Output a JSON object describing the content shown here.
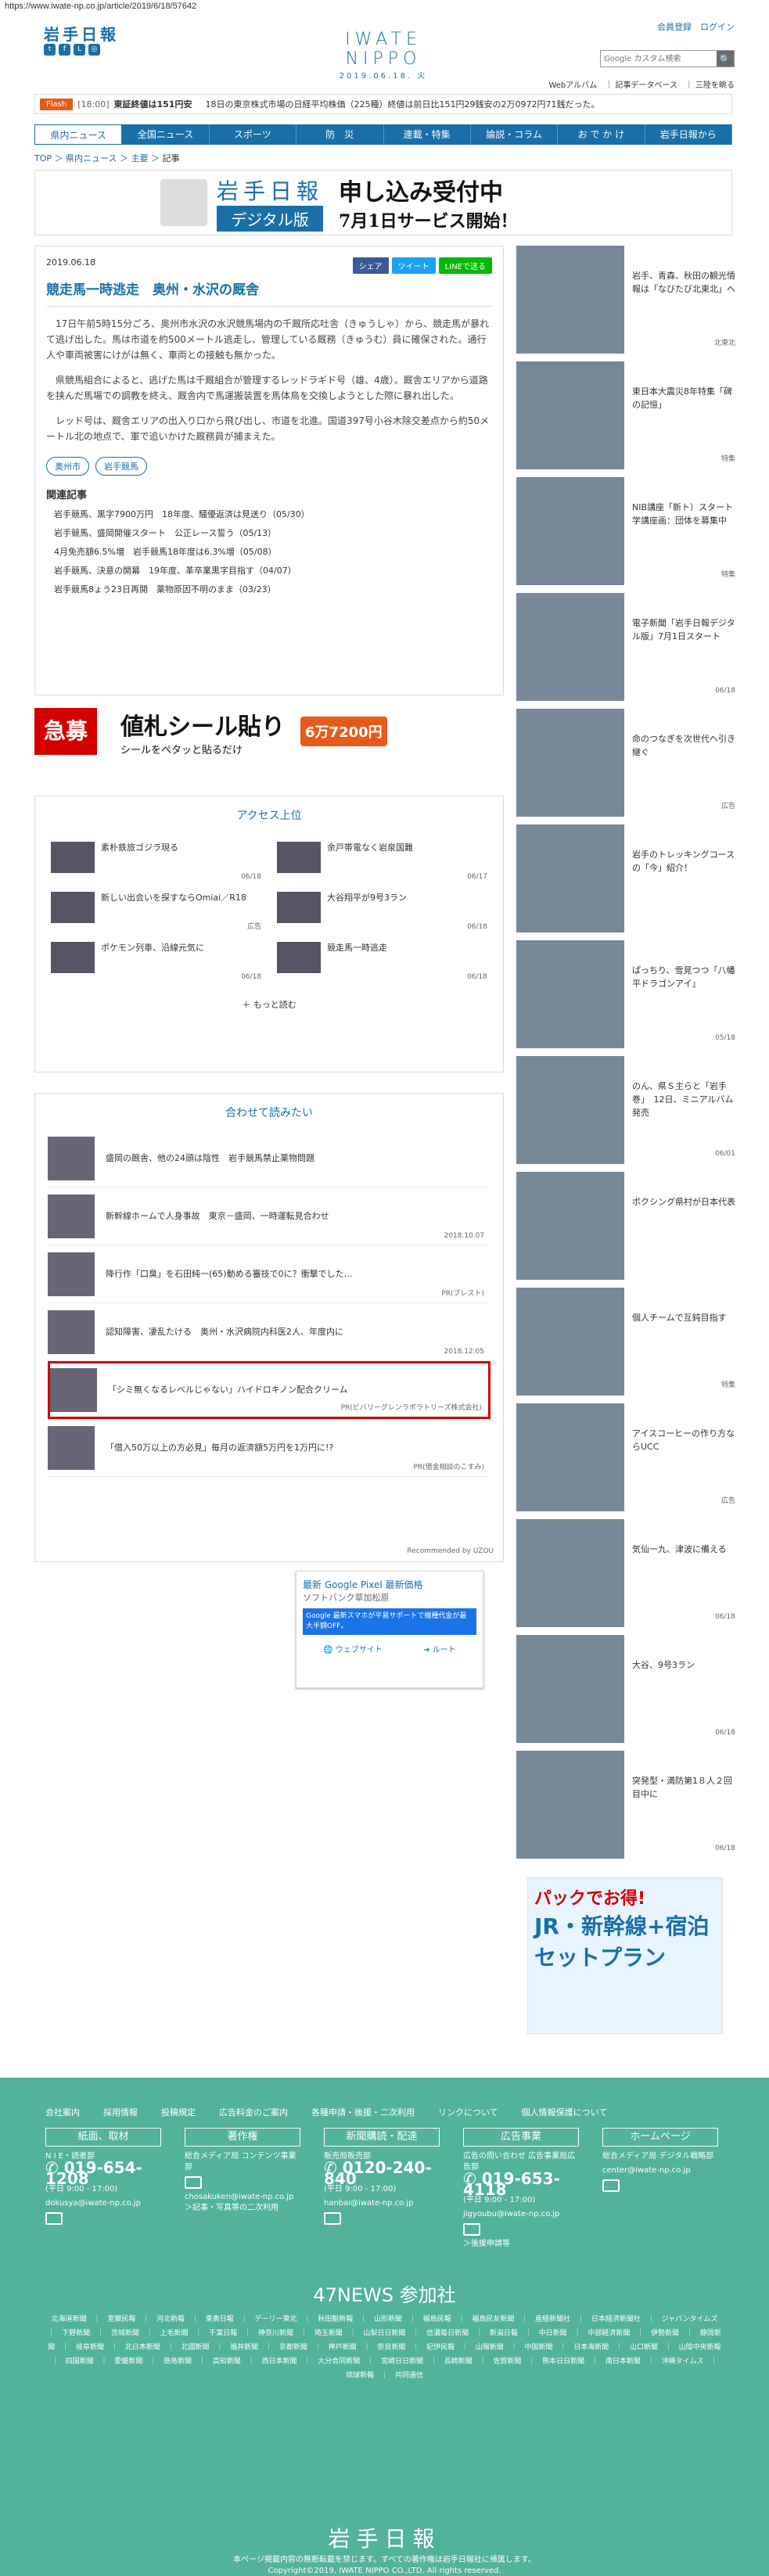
{
  "url": "https://www.iwate-np.co.jp/article/2019/6/18/57642",
  "header": {
    "logo_small": "岩手日報",
    "main_logo": "IWATE NIPPO",
    "date_line": "2019.06.18. 火",
    "account": "会員登録　ログイン",
    "search_placeholder": "Google カスタム検索",
    "search_btn": "🔍",
    "sub_links": "Webアルバム　｜ 記事データベース　｜ 三陸を眺る"
  },
  "flash": {
    "tag": "Flash",
    "time": "[18:00]",
    "headline": "東証終値は151円安",
    "text": "　18日の東京株式市場の日経平均株価（225種）終値は前日比151円29銭安の2万0972円71銭だった。"
  },
  "nav": [
    "県内ニュース",
    "全国ニュース",
    "スポーツ",
    "防　災",
    "連載・特集",
    "論説・コラム",
    "お で か け",
    "岩手日報から"
  ],
  "breadcrumb": {
    "top": "TOP",
    "s1": "県内ニュース",
    "s2": "主要",
    "cur": "記事"
  },
  "banner_top": {
    "logo": "岩手日報",
    "digital": "デジタル版",
    "line1": "申し込み受付中",
    "line2": "7月1日サービス開始！"
  },
  "article": {
    "date": "2019.06.18",
    "share": {
      "fb": "シェア",
      "tw": "ツイート",
      "ln": "LINEで送る"
    },
    "title": "競走馬一時逃走　奥州・水沢の厩舎",
    "p1": "17日午前5時15分ごろ、奥州市水沢の水沢競馬場内の千厩所応吐舎（きゅうしゃ）から、競走馬が暴れて逃げ出した。馬は市道を約500メートル逃走し、管理している厩務（きゅうむ）員に確保された。通行人や車両被害にけがは無く、車両との接触も無かった。",
    "p2": "県競馬組合によると、逃げた馬は千厩組合が管理するレッドラギド号（雄、4歳）。厩舎エリアから道路を挟んだ馬場での調教を終え、厩舎内で馬運搬装置を馬体鳥を交換しようとした際に暴れ出した。",
    "p3": "レッド号は、厩舎エリアの出入り口から飛び出し、市道を北進。国道397号小谷木除交差点から約50メートル北の地点で、軍で追いかけた厩務員が捕まえた。",
    "tags": [
      "奥州市",
      "岩手競馬"
    ],
    "related_h": "関連記事",
    "related": [
      "岩手競馬、黒字7900万円　18年度、騒優返済は見送り（05/30）",
      "岩手競馬、盛岡開催スタート　公正レース誓う（05/13）",
      "4月免売額6.5%増　岩手競馬18年度は6.3%増（05/08）",
      "岩手競馬、決意の開幕　19年度、革卒業黒字目指す（04/07）",
      "岩手競馬8ょう23日再開　薬物原因不明のまま（03/23）"
    ]
  },
  "ad_mid": {
    "kyubo": "急募",
    "main": "値札シール貼り",
    "sub": "シールをペタッと貼るだけ",
    "pay": "6万7200円"
  },
  "ranking": {
    "heading": "アクセス上位",
    "items": [
      {
        "t": "素朴鉄旅ゴジラ現る",
        "d": "06/18"
      },
      {
        "t": "余戸帯電なく岩泉国難",
        "d": "06/17"
      },
      {
        "t": "新しい出会いを探すならOmiai／R18",
        "d": "広告"
      },
      {
        "t": "大谷翔平が9号3ラン",
        "d": "06/18"
      },
      {
        "t": "ポケモン列車、沿線元気に",
        "d": "06/18"
      },
      {
        "t": "競走馬一時逃走",
        "d": "06/18"
      }
    ],
    "more": "もっと読む"
  },
  "recommend": {
    "heading": "合わせて読みたい",
    "items": [
      {
        "t": "盛岡の厩舎、他の24頭は陰性　岩手競馬禁止薬物問題",
        "d": ""
      },
      {
        "t": "新幹線ホームで人身事故　東京－盛岡、一時運転見合わせ",
        "d": "2018.10.07"
      },
      {
        "t": "降行作「口臭」を石田純一(65)動める審技で0に？衝撃でした…",
        "d": "PR(ブレスト)"
      },
      {
        "t": "認知障害、凄乱たける　奥州・水沢病院内科医2人、年度内に",
        "d": "2018.12.05"
      },
      {
        "t": "「シミ無くなるレベルじゃない」ハイドロキノン配合クリーム",
        "d": "PR(ビバリーグレンラボラトリーズ株式会社)"
      },
      {
        "t": "「借入50万以上の方必見」毎月の返済額5万円を1万円に!?",
        "d": "PR(借金相談のこすみ)"
      }
    ],
    "powered": "Recommended by UZOU"
  },
  "gad": {
    "t": "最新 Google Pixel 最新価格",
    "s": "ソフトバンク草加松原",
    "desc": "Google 最新スマホが平易サポートで機種代金が最大半額OFF。",
    "site": "ウェブサイト",
    "route": "ルート"
  },
  "side": [
    {
      "t": "岩手、青森、秋田の観光情報は「なびたび北東北」へ",
      "d": "",
      "l": "北東北"
    },
    {
      "t": "東日本大震災8年特集「碑の記憶」",
      "d": "",
      "l": "特集"
    },
    {
      "t": "NIB講座「新ト）スタート　学講座画：団体を募集中",
      "d": "",
      "l": "特集"
    },
    {
      "t": "電子新聞「岩手日報デジタル版」7月1日スタート",
      "d": "06/18",
      "l": ""
    },
    {
      "t": "命のつなぎを次世代へ引き継ぐ",
      "d": "",
      "l": "広告"
    },
    {
      "t": "岩手のトレッキングコースの「今」紹介！",
      "d": "",
      "l": ""
    },
    {
      "t": "ぱっちり、雪見つつ「八幡平ドラゴンアイ」",
      "d": "05/18",
      "l": ""
    },
    {
      "t": "のん、県Ｓ主らと「岩手巻」　12日、ミニアルバム発売",
      "d": "06/01",
      "l": ""
    },
    {
      "t": "ボクシング県村が日本代表",
      "d": "",
      "l": ""
    },
    {
      "t": "個人チームで互鈍目指す",
      "d": "",
      "l": "特集"
    },
    {
      "t": "アイスコーヒーの作り方ならUCC",
      "d": "",
      "l": "広告"
    },
    {
      "t": "気仙一九、津波に備える",
      "d": "06/18",
      "l": ""
    },
    {
      "t": "大谷、9号3ラン",
      "d": "06/18",
      "l": ""
    },
    {
      "t": "突発型・満防第1８人２回目中に",
      "d": "06/18",
      "l": ""
    }
  ],
  "side_ad": {
    "a": "パックでお得!",
    "b": "JR・新幹線+宿泊セットプラン"
  },
  "footer": {
    "links": [
      "会社案内",
      "採用情報",
      "投稿規定",
      "広告料金のご案内",
      "各種申請・後援・二次利用",
      "リンクについて",
      "個人情報保護について"
    ],
    "cols": [
      {
        "h": "紙面、取材",
        "dept": "N I E・読者部",
        "tel": "019-654-1208",
        "hours": "(平日 9:00 - 17:00)",
        "mail": "dokusya@iwate-np.co.jp"
      },
      {
        "h": "著作権",
        "dept": "総合メディア局 コンテンツ事業部",
        "tel": "",
        "hours": "",
        "mail": "chosakuken@iwate-np.co.jp",
        "extra": "＞記事・写真等の二次利用"
      },
      {
        "h": "新聞購読・配達",
        "dept": "販売局販売部",
        "tel": "0120-240-840",
        "hours": "(平日 9:00 - 17:00)",
        "mail": "hanbai@iwate-np.co.jp"
      },
      {
        "h": "広告事業",
        "dept": "広告の問い合わせ 広告事業局広告部",
        "tel": "019-653-4118",
        "hours": "(平日 9:00 - 17:00)",
        "mail": "jigyoubu@iwate-np.co.jp",
        "extra": "＞後援申請等"
      },
      {
        "h": "ホームページ",
        "dept": "総合メディア局 デジタル戦略部",
        "tel": "",
        "hours": "",
        "mail": "center@iwate-np.co.jp"
      }
    ],
    "n47": "47NEWS 参加社",
    "n47list": "北海道新聞 ｜ 室蘭民報 ｜ 河北新報 ｜ 東奥日報 ｜ デーリー東北 ｜ 秋田魁新報 ｜ 山形新聞 ｜ 福島民報 ｜ 福島民友新聞 ｜ 産経新聞社 ｜ 日本経済新聞社 ｜ ジャパンタイムズ ｜ 下野新聞 ｜ 茨城新聞 ｜ 上毛新聞 ｜ 千葉日報 ｜ 神奈川新聞 ｜ 埼玉新聞 ｜ 山梨日日新聞 ｜ 信濃毎日新聞 ｜ 新潟日報 ｜ 中日新聞 ｜ 中部経済新聞 ｜ 伊勢新聞 ｜ 静岡新聞 ｜ 岐阜新聞 ｜ 北日本新聞 ｜ 北國新聞 ｜ 福井新聞 ｜ 京都新聞 ｜ 神戸新聞 ｜ 奈良新聞 ｜ 紀伊民報 ｜ 山陽新聞 ｜ 中国新聞 ｜ 日本海新聞 ｜ 山口新聞 ｜ 山陰中央新報 ｜ 四国新聞 ｜ 愛媛新聞 ｜ 徳島新聞 ｜ 高知新聞 ｜ 西日本新聞 ｜ 大分合同新聞 ｜ 宮崎日日新聞 ｜ 長崎新聞 ｜ 佐賀新聞 ｜ 熊本日日新聞 ｜ 南日本新聞 ｜ 沖縄タイムス ｜ 琉球新報 ｜ 共同通信",
    "logo": "岩手日報",
    "copy1": "本ページ掲載内容の無断転載を禁じます。すべての著作権は岩手日報社に帰属します。",
    "copy2": "Copyright©2019, IWATE NIPPO CO.,LTD. All rights reserved."
  }
}
